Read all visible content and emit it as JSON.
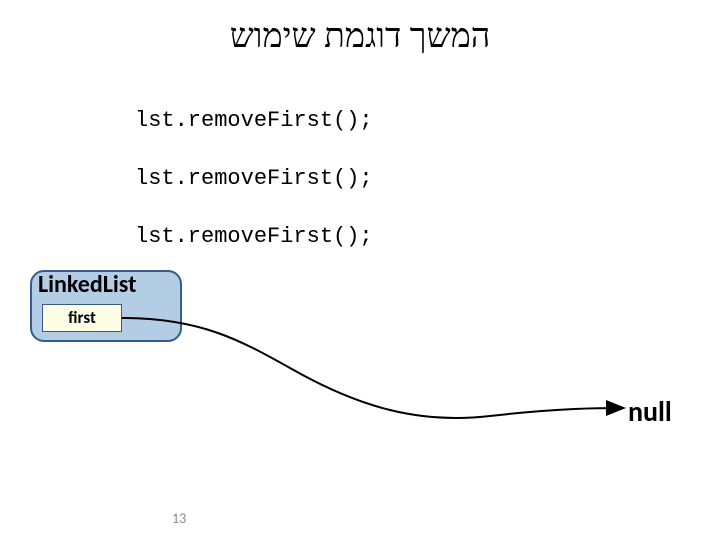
{
  "title": "המשך דוגמת שימוש",
  "code_lines": {
    "l1": "lst.removeFirst();",
    "l2": "lst.removeFirst();",
    "l3": "lst.removeFirst();"
  },
  "node": {
    "class_name": "LinkedList",
    "field_name": "first"
  },
  "pointer_target": "null",
  "page_number": "13"
}
